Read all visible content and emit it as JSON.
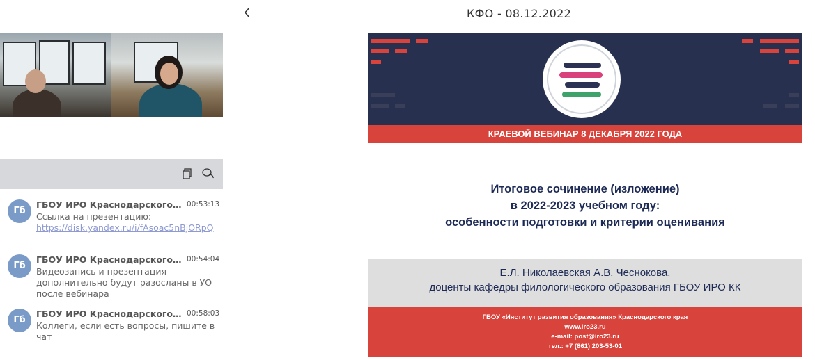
{
  "header": {
    "title": "КФО - 08.12.2022",
    "back_icon": "chevron-left-icon"
  },
  "chat": {
    "toolbar_icons": [
      "document-copy-icon",
      "chat-bubbles-icon"
    ],
    "messages": [
      {
        "avatar": "Гб",
        "sender": "ГБОУ ИРО Краснодарского края",
        "time": "00:53:13",
        "text": "Ссылка на презентацию:",
        "link": "https://disk.yandex.ru/i/fAsoac5nBjORpQ"
      },
      {
        "avatar": "Гб",
        "sender": "ГБОУ ИРО Краснодарского края",
        "time": "00:54:04",
        "text": "Видеозапись и презентация дополнительно будут разосланы в УО после вебинара"
      },
      {
        "avatar": "Гб",
        "sender": "ГБОУ ИРО Краснодарского края",
        "time": "00:58:03",
        "text": "Коллеги, если есть вопросы, пишите в чат"
      }
    ]
  },
  "slide": {
    "banner": "КРАЕВОЙ ВЕБИНАР 8 ДЕКАБРЯ  2022 ГОДА",
    "title_line1": "Итоговое сочинение (изложение)",
    "title_line2": "в 2022-2023 учебном году:",
    "title_line3": "особенности подготовки и критерии оценивания",
    "authors_line1": "Е.Л. Николаевская А.В. Чеснокова,",
    "authors_line2": "доценты кафедры филологического образования ГБОУ ИРО КК",
    "footer_line1": "ГБОУ «Институт развития образования» Краснодарского края",
    "footer_line2": "www.iro23.ru",
    "footer_line3": "e-mail: post@iro23.ru",
    "footer_line4": "тел.: +7 (861) 203-53-01",
    "colors": {
      "navy": "#283050",
      "red": "#d8433c",
      "gray": "#dedede",
      "text": "#1d2a55"
    }
  }
}
